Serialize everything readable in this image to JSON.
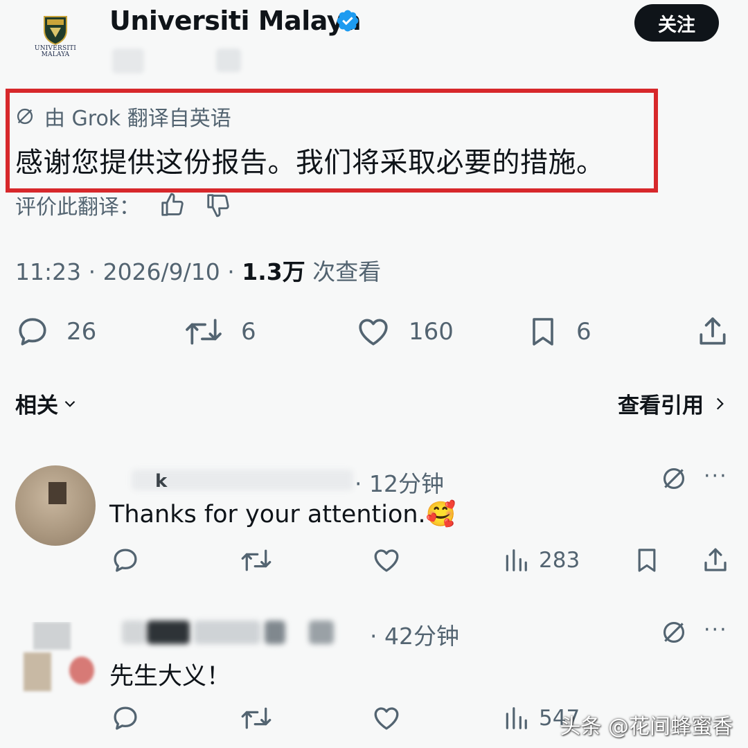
{
  "account": {
    "name": "Universiti Malaya",
    "logo_text": [
      "UNIVERSITI",
      "MALAYA"
    ],
    "verified": true,
    "follow_label": "关注"
  },
  "translation": {
    "header": "由 Grok 翻译自英语",
    "text": "感谢您提供这份报告。我们将采取必要的措施。",
    "rate_label": "评价此翻译："
  },
  "meta": {
    "time_date": "11:23 · 2026/9/10 · ",
    "views": "1.3万",
    "views_label": " 次查看"
  },
  "actions": {
    "replies": "26",
    "reposts": "6",
    "likes": "160",
    "bookmarks": "6"
  },
  "sections": {
    "related_label": "相关",
    "quotes_label": "查看引用"
  },
  "replies": [
    {
      "visible_name_fragment": "k",
      "time": "· 12分钟",
      "text": "Thanks for your attention.",
      "emoji": "🥰",
      "views": "283"
    },
    {
      "time": "· 42分钟",
      "text": "先生大义！",
      "views": "547"
    }
  ],
  "watermark": "头条 @花间蜂蜜香",
  "colors": {
    "highlight_border": "#d7282b",
    "verified_blue": "#1d9bf0",
    "text_primary": "#0f1419",
    "text_secondary": "#536471"
  }
}
